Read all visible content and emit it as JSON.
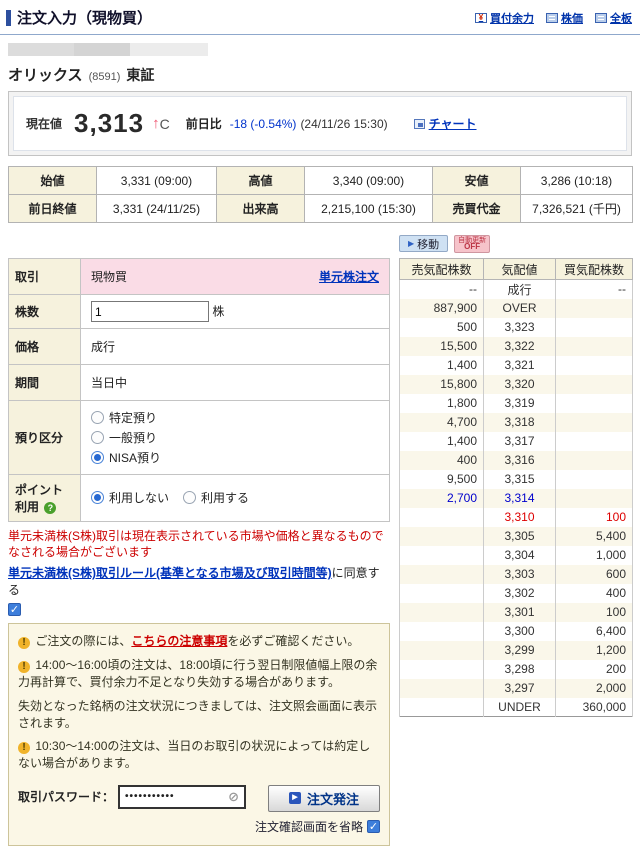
{
  "header": {
    "title": "注文入力（現物買）",
    "links": [
      {
        "label": "買付余力"
      },
      {
        "label": "株価"
      },
      {
        "label": "全板"
      }
    ]
  },
  "stock": {
    "name": "オリックス",
    "code": "(8591)",
    "market": "東証"
  },
  "quote": {
    "current_label": "現在値",
    "current_price": "3,313",
    "tick_arrow": "↑",
    "tick_flag": "C",
    "change_label": "前日比",
    "change_value": "-18 (-0.54%)",
    "change_time": "(24/11/26 15:30)",
    "chart_link": "チャート"
  },
  "summary": {
    "rows": [
      [
        {
          "label": "始値",
          "value": "3,331 (09:00)"
        },
        {
          "label": "高値",
          "value": "3,340 (09:00)"
        },
        {
          "label": "安値",
          "value": "3,286 (10:18)"
        }
      ],
      [
        {
          "label": "前日終値",
          "value": "3,331 (24/11/25)"
        },
        {
          "label": "出来高",
          "value": "2,215,100 (15:30)"
        },
        {
          "label": "売買代金",
          "value": "7,326,521 (千円)"
        }
      ]
    ]
  },
  "board_controls": {
    "move_button": "移動",
    "auto_update_line1": "自動更新",
    "auto_update_line2": "OFF"
  },
  "order_form": {
    "trade": {
      "label": "取引",
      "value": "現物買",
      "link": "単元株注文"
    },
    "quantity": {
      "label": "株数",
      "value": "1",
      "unit": "株"
    },
    "price": {
      "label": "価格",
      "value": "成行"
    },
    "period": {
      "label": "期間",
      "value": "当日中"
    },
    "deposit": {
      "label": "預り区分",
      "options": [
        {
          "label": "特定預り",
          "selected": false
        },
        {
          "label": "一般預り",
          "selected": false
        },
        {
          "label": "NISA預り",
          "selected": true
        }
      ]
    },
    "points": {
      "label_line1": "ポイント",
      "label_line2": "利用",
      "options": [
        {
          "label": "利用しない",
          "selected": true
        },
        {
          "label": "利用する",
          "selected": false
        }
      ]
    }
  },
  "warnings": {
    "notice": "単元未満株(S株)取引は現在表示されている市場や価格と異なるものでなされる場合がございます",
    "rule_link": "単元未満株(S株)取引ルール(基準となる市場及び取引時間等)",
    "rule_suffix": "に同意する",
    "agree_checked": true
  },
  "notes": {
    "line1_pre": "ご注文の際には、",
    "line1_link": "こちらの注意事項",
    "line1_post": "を必ずご確認ください。",
    "line2": "14:00～16:00頃の注文は、18:00頃に行う翌日制限値幅上限の余力再計算で、買付余力不足となり失効する場合があります。",
    "line3": "失効となった銘柄の注文状況につきましては、注文照会画面に表示されます。",
    "line4": "10:30～14:00の注文は、当日のお取引の状況によっては約定しない場合があります。"
  },
  "order_submit": {
    "password_label": "取引パスワード：",
    "password_value": "•••••••••••",
    "submit_button": "注文発注",
    "skip_confirm_label": "注文確認画面を省略",
    "skip_confirm_checked": true
  },
  "order_book": {
    "headers": [
      "売気配株数",
      "気配値",
      "買気配株数"
    ],
    "rows": [
      {
        "sell": "--",
        "price": "成行",
        "buy": "--"
      },
      {
        "sell": "887,900",
        "price": "OVER",
        "buy": ""
      },
      {
        "sell": "500",
        "price": "3,323",
        "buy": ""
      },
      {
        "sell": "15,500",
        "price": "3,322",
        "buy": ""
      },
      {
        "sell": "1,400",
        "price": "3,321",
        "buy": ""
      },
      {
        "sell": "15,800",
        "price": "3,320",
        "buy": ""
      },
      {
        "sell": "1,800",
        "price": "3,319",
        "buy": ""
      },
      {
        "sell": "4,700",
        "price": "3,318",
        "buy": ""
      },
      {
        "sell": "1,400",
        "price": "3,317",
        "buy": ""
      },
      {
        "sell": "400",
        "price": "3,316",
        "buy": ""
      },
      {
        "sell": "9,500",
        "price": "3,315",
        "buy": ""
      },
      {
        "sell": "2,700",
        "price": "3,314",
        "buy": "",
        "color": "blue"
      },
      {
        "sell": "",
        "price": "3,310",
        "buy": "100",
        "color": "red"
      },
      {
        "sell": "",
        "price": "3,305",
        "buy": "5,400"
      },
      {
        "sell": "",
        "price": "3,304",
        "buy": "1,000"
      },
      {
        "sell": "",
        "price": "3,303",
        "buy": "600"
      },
      {
        "sell": "",
        "price": "3,302",
        "buy": "400"
      },
      {
        "sell": "",
        "price": "3,301",
        "buy": "100"
      },
      {
        "sell": "",
        "price": "3,300",
        "buy": "6,400"
      },
      {
        "sell": "",
        "price": "3,299",
        "buy": "1,200"
      },
      {
        "sell": "",
        "price": "3,298",
        "buy": "200"
      },
      {
        "sell": "",
        "price": "3,297",
        "buy": "2,000"
      },
      {
        "sell": "",
        "price": "UNDER",
        "buy": "360,000"
      }
    ]
  },
  "colors": {
    "accent_navy": "#2d4f9e",
    "link_blue": "#0033bb",
    "change_blue": "#0033cc",
    "warning_red": "#cc0000",
    "best_ask_blue": "#0000cc",
    "best_bid_red": "#dd0000",
    "label_beige": "#f6f2dd",
    "trade_row_pink": "#fadce6",
    "notes_beige": "#fbf7e6"
  }
}
